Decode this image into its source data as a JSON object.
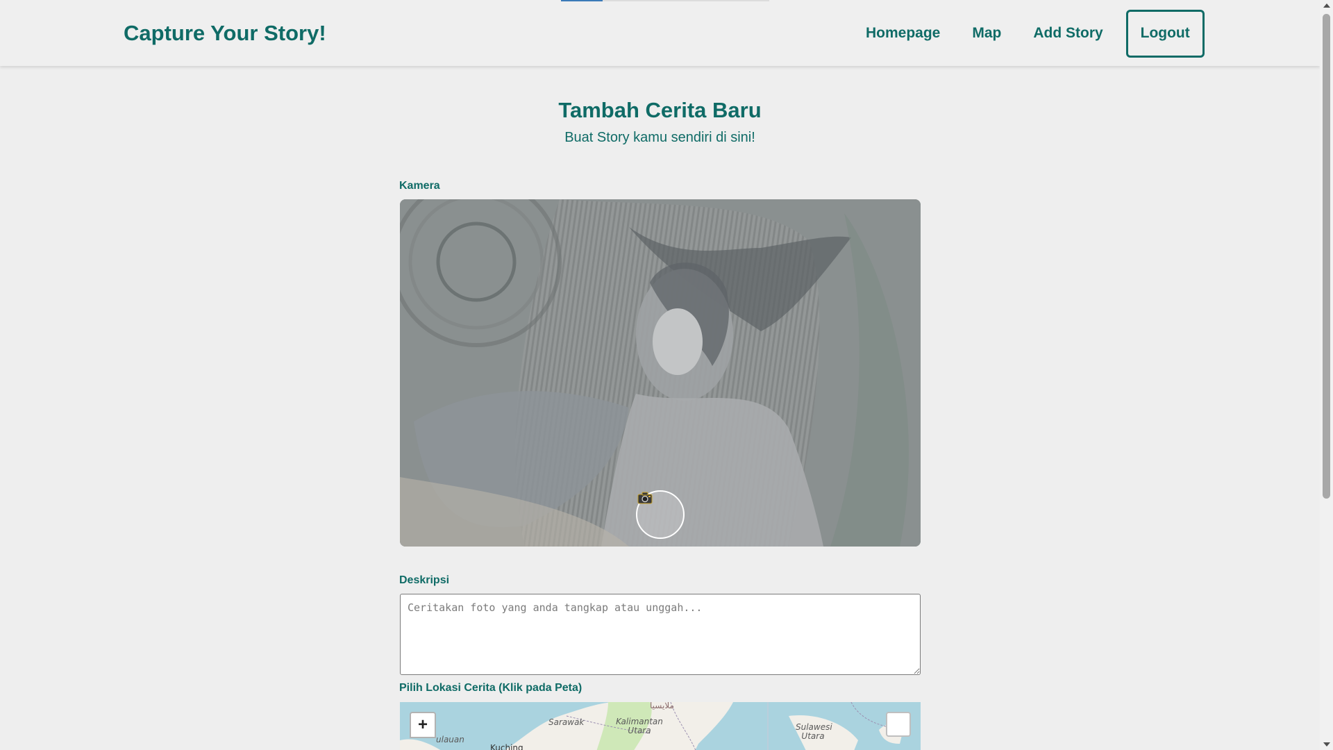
{
  "header": {
    "brand": "Capture Your Story!",
    "nav": {
      "homepage": "Homepage",
      "map": "Map",
      "add_story": "Add Story",
      "logout": "Logout"
    }
  },
  "main": {
    "title": "Tambah Cerita Baru",
    "subtitle": "Buat Story kamu sendiri di sini!",
    "camera_label": "Kamera",
    "capture_icon": "camera-icon",
    "description_label": "Deskripsi",
    "description_placeholder": "Ceritakan foto yang anda tangkap atau unggah...",
    "description_value": "",
    "location_label": "Pilih Lokasi Cerita (Klik pada Peta)"
  },
  "map": {
    "zoom_in": "+",
    "places": {
      "sarawak": "Sarawak",
      "kuching": "Kuching",
      "kalimantan_utara": "Kalimantan Utara",
      "sulawesi_utara": "Sulawesi Utara",
      "pulauan": "ulauan",
      "malaysia_arabic": "ملايسيا"
    },
    "colors": {
      "water": "#aad3df",
      "land": "#f2efe9",
      "forest": "#cfe8b8"
    }
  },
  "colors": {
    "accent": "#0f6b66",
    "background": "#eeeeee"
  }
}
